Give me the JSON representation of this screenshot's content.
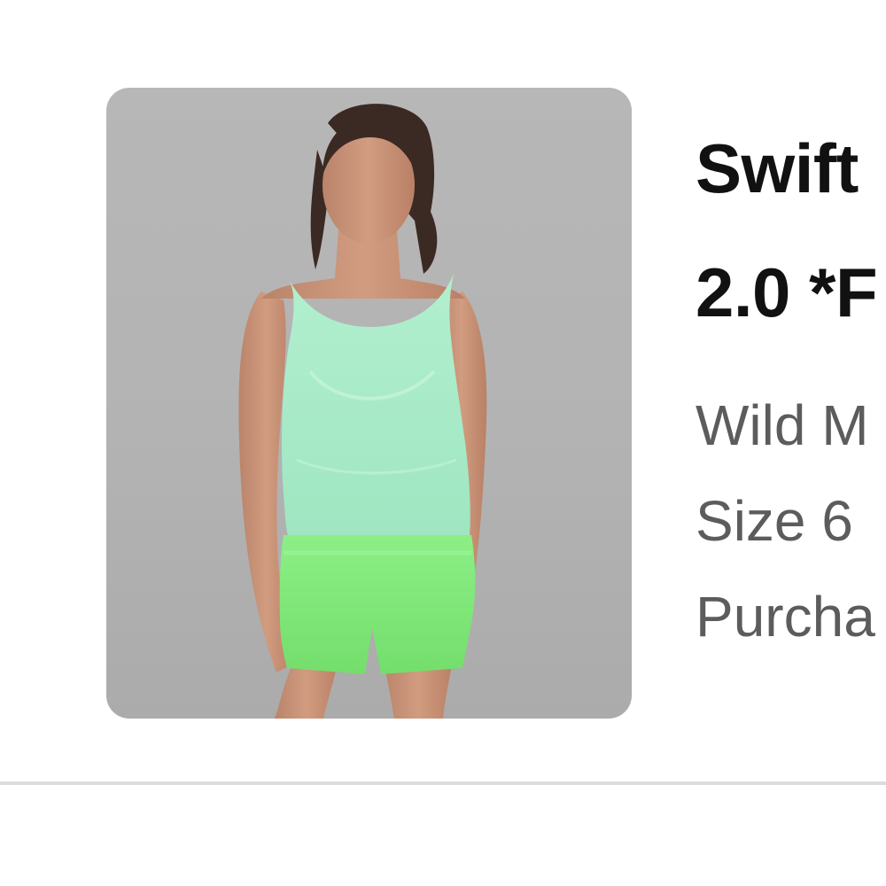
{
  "product": {
    "title_line1": "Swift",
    "title_line2": "2.0 *F",
    "color": "Wild M",
    "size": "Size 6",
    "purchase": "Purcha"
  },
  "image": {
    "subject": "model wearing mint green tank top and bright green running shorts",
    "background_color": "#b3b3b3",
    "top_color": "#a8ebc6",
    "shorts_color": "#86ec7d"
  },
  "colors": {
    "title_text": "#111111",
    "meta_text": "#5c5c5c",
    "divider": "#dcdcdc"
  }
}
